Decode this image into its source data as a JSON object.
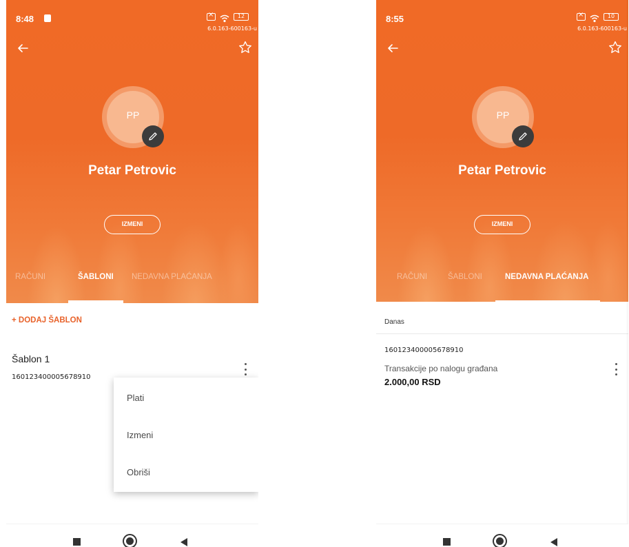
{
  "colors": {
    "accent": "#EE6A28",
    "accent_text": "#E8622A",
    "header_text": "#FFFFFF",
    "edit_button_bg": "#3C3C3C"
  },
  "left_screen": {
    "status": {
      "time": "8:48",
      "battery": "12",
      "version": "6.0.163-600163-u"
    },
    "profile": {
      "initials": "PP",
      "name": "Petar Petrovic",
      "edit_button": "IZMENI"
    },
    "tabs": [
      {
        "label": "RAČUNI",
        "active": false
      },
      {
        "label": "ŠABLONI",
        "active": true
      },
      {
        "label": "NEDAVNA PLAĆANJA",
        "active": false
      }
    ],
    "add_template_label": "+ DODAJ ŠABLON",
    "template": {
      "name": "Šablon 1",
      "account": "160123400005678910"
    },
    "context_menu": [
      "Plati",
      "Izmeni",
      "Obriši"
    ]
  },
  "right_screen": {
    "status": {
      "time": "8:55",
      "battery": "10",
      "version": "6.0.163-600163-u"
    },
    "profile": {
      "initials": "PP",
      "name": "Petar Petrovic",
      "edit_button": "IZMENI"
    },
    "tabs": [
      {
        "label": "RAČUNI",
        "active": false
      },
      {
        "label": "ŠABLONI",
        "active": false
      },
      {
        "label": "NEDAVNA PLAĆANJA",
        "active": true
      }
    ],
    "section_label": "Danas",
    "recent_payment": {
      "account": "160123400005678910",
      "description": "Transakcije po nalogu građana",
      "amount": "2.000,00 RSD"
    }
  }
}
